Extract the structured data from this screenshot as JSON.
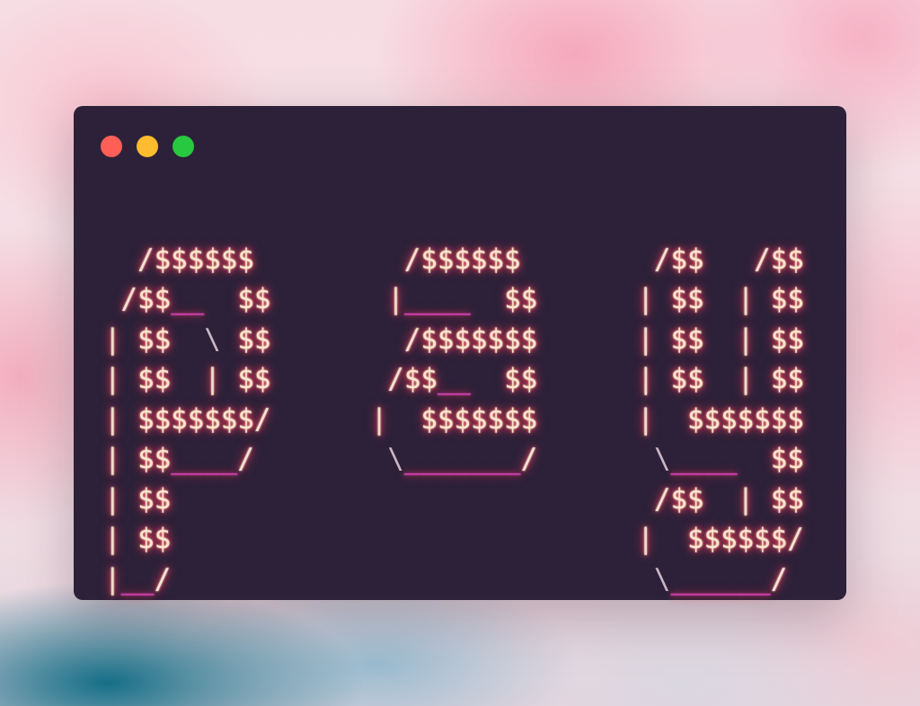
{
  "window": {
    "controls": [
      {
        "name": "close",
        "color": "#ff5f57"
      },
      {
        "name": "minimize",
        "color": "#febc2e"
      },
      {
        "name": "zoom",
        "color": "#28c840"
      }
    ]
  },
  "colors": {
    "dollar": "#fbe6cc",
    "slash": "#f6e4d2",
    "pipe": "#f2dcc8",
    "backslash": "#c9b7c6",
    "underscore": "#e346c0",
    "glow": "#ff3c5a"
  },
  "ascii_art": {
    "lines": [
      "  /$$$$$$         /$$$$$$        /$$   /$$",
      " /$$__  $$       |____  $$      | $$  | $$",
      "| $$  \\ $$        /$$$$$$$      | $$  | $$",
      "| $$  | $$       /$$__  $$      | $$  | $$",
      "| $$$$$$$/      |  $$$$$$$      |  $$$$$$$",
      "| $$____/        \\_______/       \\____  $$",
      "| $$                             /$$  | $$",
      "| $$                            |  $$$$$$/",
      "|__/                             \\______/"
    ]
  }
}
